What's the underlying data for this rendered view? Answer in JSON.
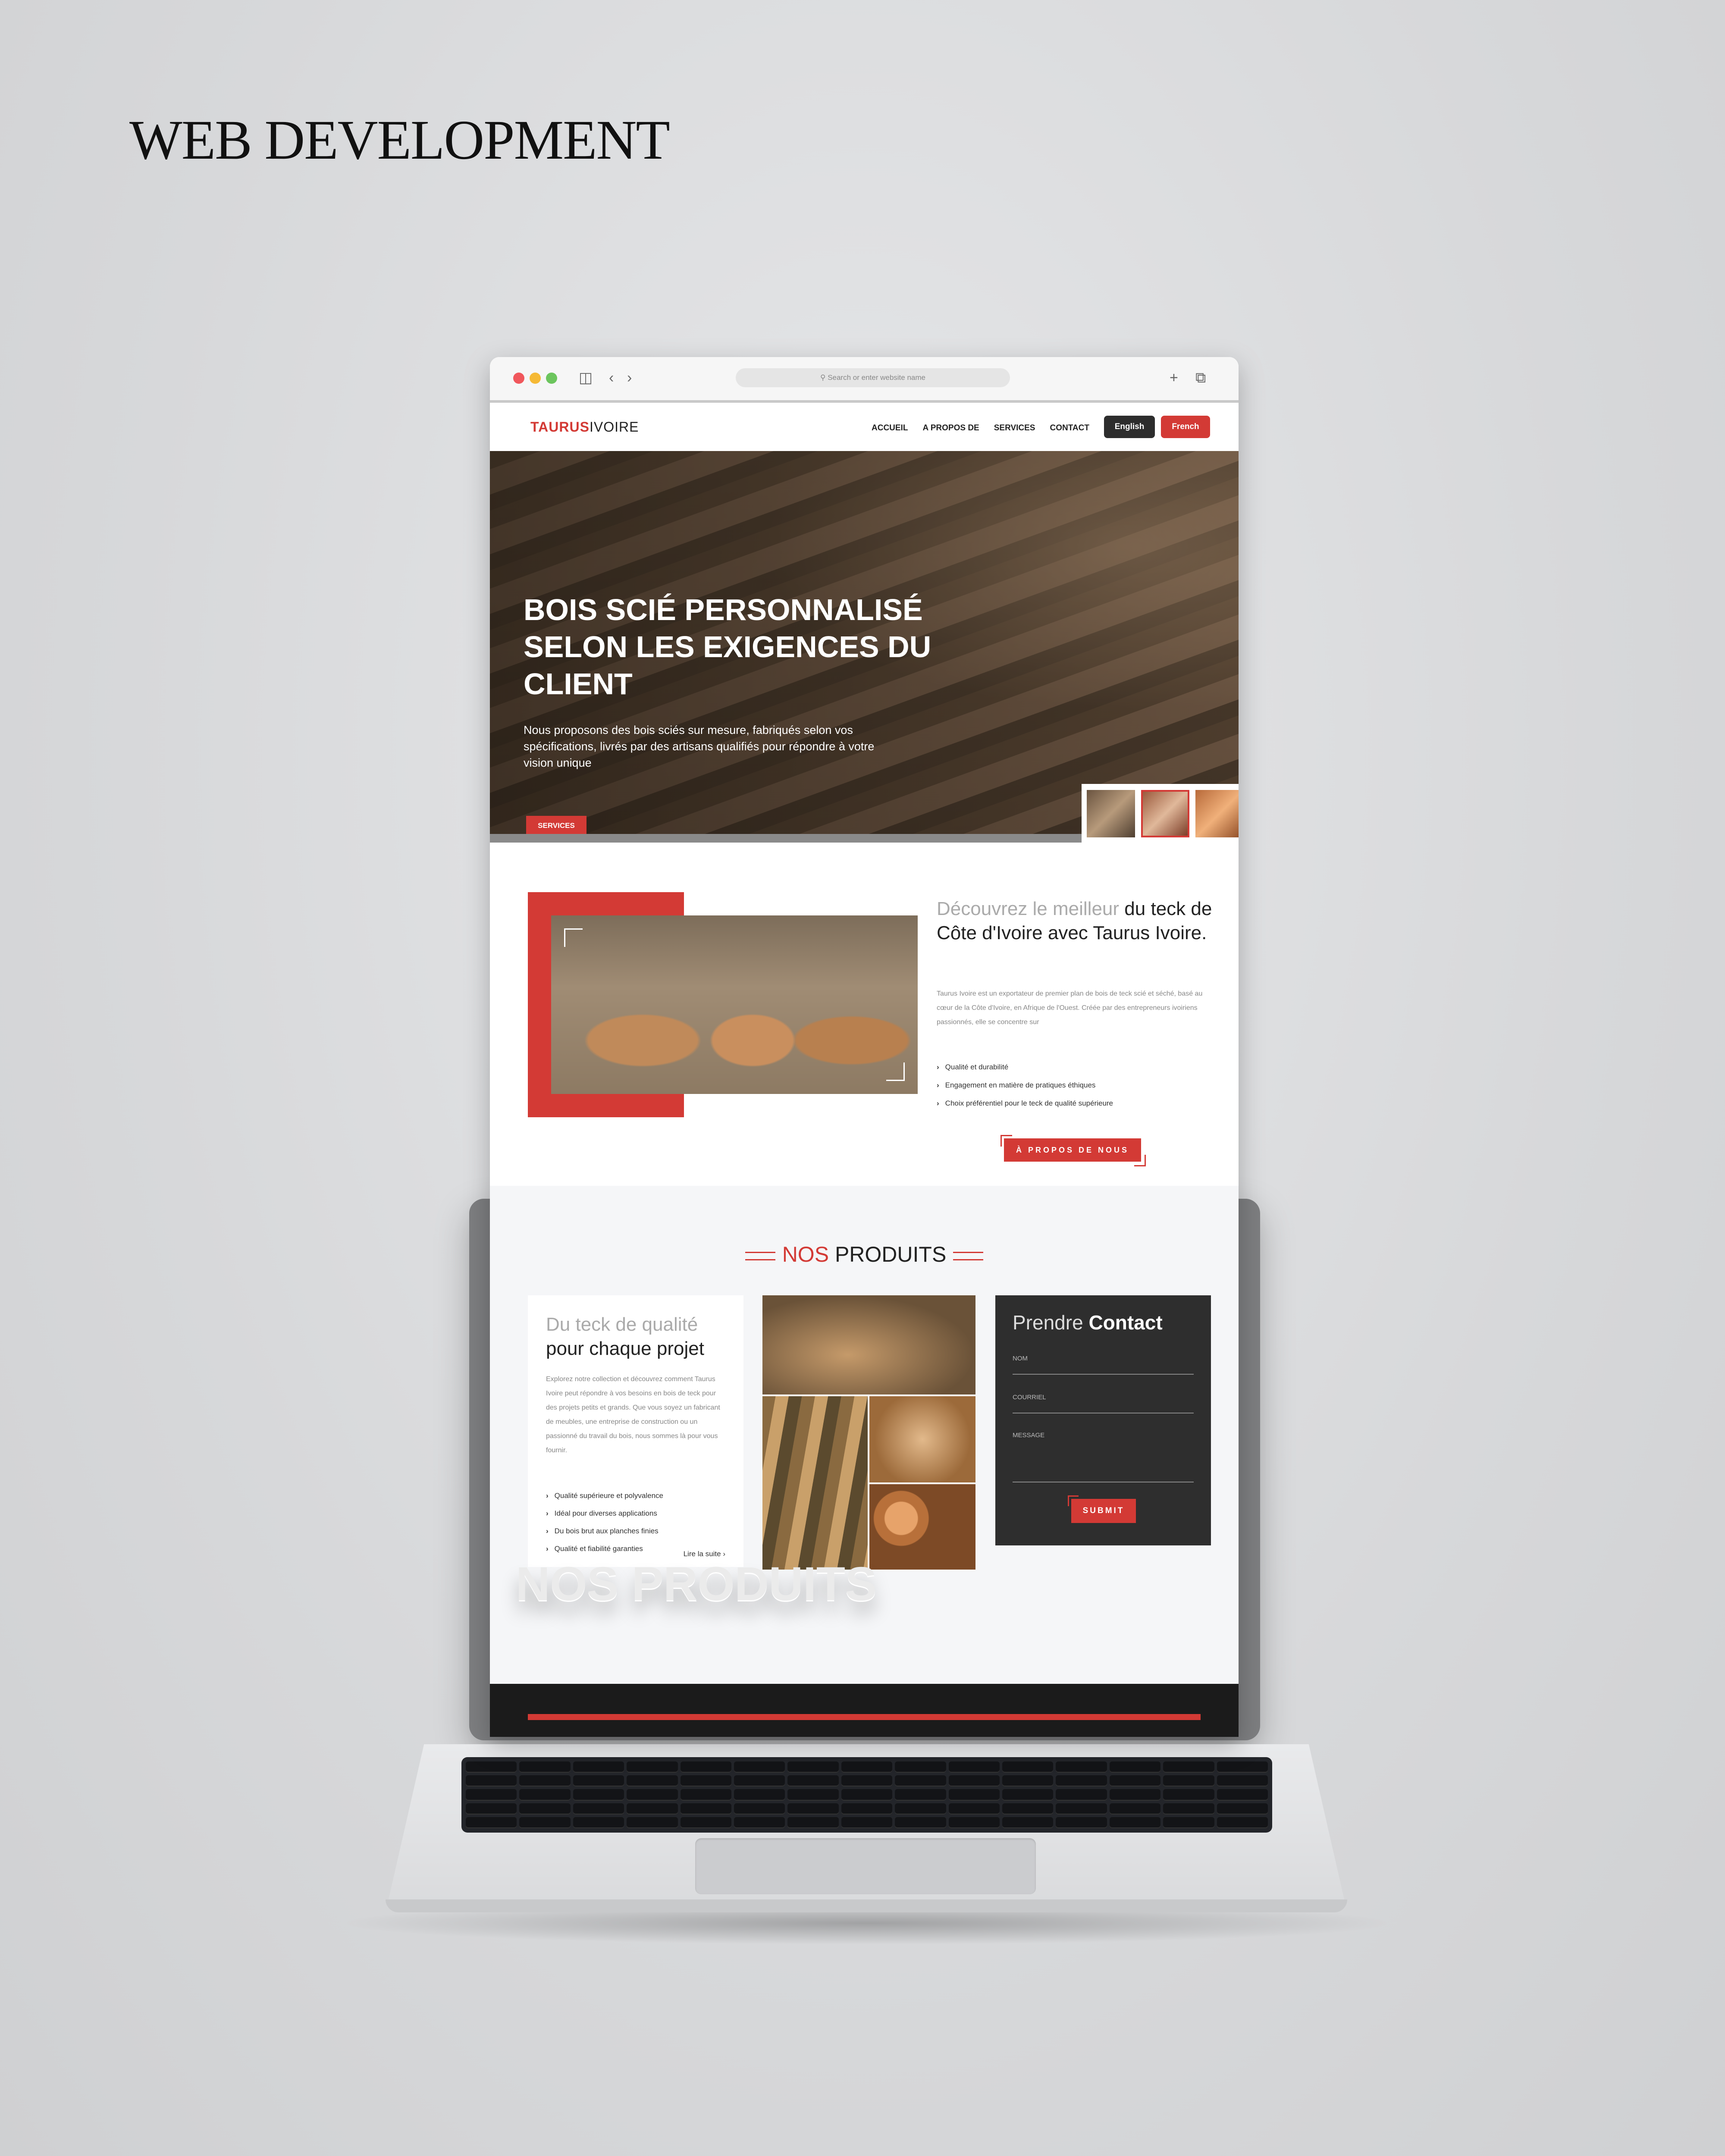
{
  "heading": "WEB DEVELOPMENT",
  "browser": {
    "address_placeholder": "Search or enter website name"
  },
  "nav": {
    "logo_part1": "TAURUS",
    "logo_part2": "IVOIRE",
    "links": [
      "ACCUEIL",
      "A PROPOS DE",
      "SERVICES",
      "CONTACT"
    ],
    "lang_en": "English",
    "lang_fr": "French"
  },
  "hero": {
    "title": "BOIS SCIÉ PERSONNALISÉ SELON LES EXIGENCES DU CLIENT",
    "description": "Nous proposons des bois sciés sur mesure, fabriqués selon vos spécifications, livrés par des artisans qualifiés pour répondre à votre vision unique",
    "button": "SERVICES"
  },
  "about": {
    "title_light": "Découvrez le meilleur",
    "title_strong": "du teck de Côte d'Ivoire avec Taurus Ivoire.",
    "description": "Taurus Ivoire est un exportateur de premier plan de bois de teck scié et séché, basé au cœur de la Côte d'Ivoire, en Afrique de l'Ouest. Créée par des entrepreneurs ivoiriens passionnés, elle se concentre sur",
    "list": [
      "Qualité et durabilité",
      "Engagement en matière de pratiques éthiques",
      "Choix préférentiel pour le teck de qualité supérieure"
    ],
    "button": "À PROPOS DE NOUS"
  },
  "products": {
    "heading_light": "NOS",
    "heading_strong": "PRODUITS",
    "card": {
      "title_light": "Du teck de qualité",
      "title_strong": "pour chaque projet",
      "description": "Explorez notre collection et découvrez comment Taurus Ivoire peut répondre à vos besoins en bois de teck pour des projets petits et grands. Que vous soyez un fabricant de meubles, une entreprise de construction ou un passionné du travail du bois, nous sommes là pour vous fournir.",
      "list": [
        "Qualité supérieure et polyvalence",
        "Idéal pour diverses applications",
        "Du bois brut aux planches finies",
        "Qualité et fiabilité garanties"
      ],
      "read_more": "Lire la suite"
    },
    "contact": {
      "title_light": "Prendre",
      "title_strong": "Contact",
      "field_nom": "NOM",
      "field_courriel": "COURRIEL",
      "field_message": "MESSAGE",
      "submit": "SUBMIT"
    },
    "ghost_text": "NOS PRODUITS"
  },
  "colors": {
    "accent": "#d33a35",
    "dark": "#2e2e2e",
    "section_bg": "#f5f6f8"
  }
}
